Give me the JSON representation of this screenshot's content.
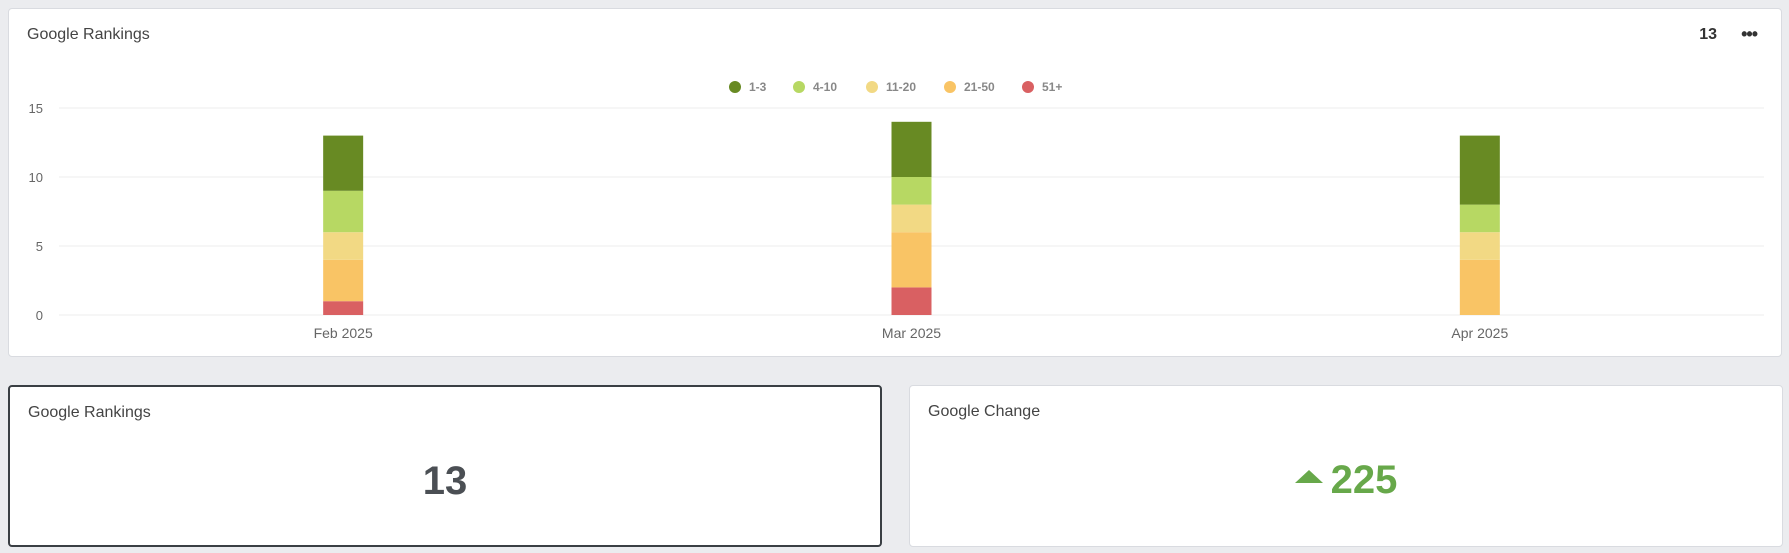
{
  "header": {
    "title": "Google Rankings",
    "count": "13",
    "more_label": "•••"
  },
  "chart_data": {
    "type": "bar",
    "stacked": true,
    "categories": [
      "Feb 2025",
      "Mar 2025",
      "Apr 2025"
    ],
    "series": [
      {
        "name": "51+",
        "color": "#d96062",
        "values": [
          1,
          2,
          0
        ]
      },
      {
        "name": "21-50",
        "color": "#f9c465",
        "values": [
          3,
          4,
          4
        ]
      },
      {
        "name": "11-20",
        "color": "#f2d984",
        "values": [
          2,
          2,
          2
        ]
      },
      {
        "name": "4-10",
        "color": "#b7d863",
        "values": [
          3,
          2,
          2
        ]
      },
      {
        "name": "1-3",
        "color": "#688a23",
        "values": [
          4,
          4,
          5
        ]
      }
    ],
    "legend_order": [
      "1-3",
      "4-10",
      "11-20",
      "21-50",
      "51+"
    ],
    "yticks": [
      "0",
      "5",
      "10",
      "15"
    ],
    "ylim": [
      0,
      15
    ],
    "grid": true,
    "legend_position": "top-center"
  },
  "rankings_card": {
    "title": "Google Rankings",
    "value": "13"
  },
  "change_card": {
    "title": "Google Change",
    "value": "225",
    "direction_icon": "arrow-up-icon"
  }
}
